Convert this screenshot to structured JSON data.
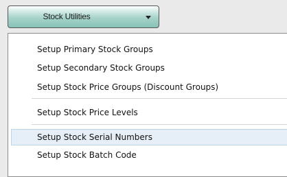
{
  "toolbar": {
    "stock_utilities_label": "Stock Utilities"
  },
  "menu": {
    "items": [
      {
        "label": "Setup Primary Stock Groups"
      },
      {
        "label": "Setup Secondary Stock Groups"
      },
      {
        "label": "Setup Stock Price Groups (Discount Groups)"
      },
      {
        "label": "Setup Stock Price Levels"
      },
      {
        "label": "Setup Stock Serial Numbers",
        "highlighted": true
      },
      {
        "label": "Setup Stock Batch Code"
      }
    ]
  }
}
